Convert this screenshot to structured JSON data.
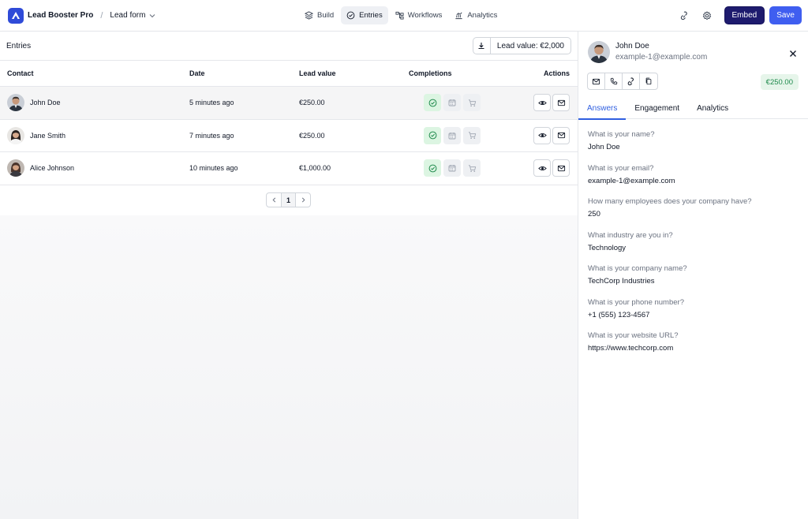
{
  "header": {
    "app_name": "Lead Booster Pro",
    "separator": "/",
    "form_name": "Lead form",
    "nav": [
      {
        "label": "Build",
        "icon": "layers-icon"
      },
      {
        "label": "Entries",
        "icon": "check-circle-icon",
        "active": true
      },
      {
        "label": "Workflows",
        "icon": "workflow-icon"
      },
      {
        "label": "Analytics",
        "icon": "chart-icon"
      }
    ],
    "embed_label": "Embed",
    "save_label": "Save"
  },
  "entries": {
    "title": "Entries",
    "lead_value_label": "Lead value: €2,000",
    "columns": {
      "contact": "Contact",
      "date": "Date",
      "lead_value": "Lead value",
      "completions": "Completions",
      "actions": "Actions"
    },
    "rows": [
      {
        "name": "John Doe",
        "date": "5 minutes ago",
        "lead_value": "€250.00",
        "completed": true,
        "selected": true
      },
      {
        "name": "Jane Smith",
        "date": "7 minutes ago",
        "lead_value": "€250.00",
        "completed": true,
        "selected": false
      },
      {
        "name": "Alice Johnson",
        "date": "10 minutes ago",
        "lead_value": "€1,000.00",
        "completed": true,
        "selected": false
      }
    ],
    "page": "1"
  },
  "drawer": {
    "name": "John Doe",
    "email": "example-1@example.com",
    "value": "€250.00",
    "tabs": [
      "Answers",
      "Engagement",
      "Analytics"
    ],
    "answers": [
      {
        "q": "What is your name?",
        "a": "John Doe"
      },
      {
        "q": "What is your email?",
        "a": "example-1@example.com"
      },
      {
        "q": "How many employees does your company have?",
        "a": "250"
      },
      {
        "q": "What industry are you in?",
        "a": "Technology"
      },
      {
        "q": "What is your company name?",
        "a": "TechCorp Industries"
      },
      {
        "q": "What is your phone number?",
        "a": "+1 (555) 123-4567"
      },
      {
        "q": "What is your website URL?",
        "a": "https://www.techcorp.com"
      }
    ]
  },
  "colors": {
    "accent": "#2f5fe0",
    "embed_bg": "#1e1b6e",
    "save_bg": "#3f5ef0",
    "success_bg": "#dcf5e2",
    "success_text": "#1f8a4c"
  }
}
